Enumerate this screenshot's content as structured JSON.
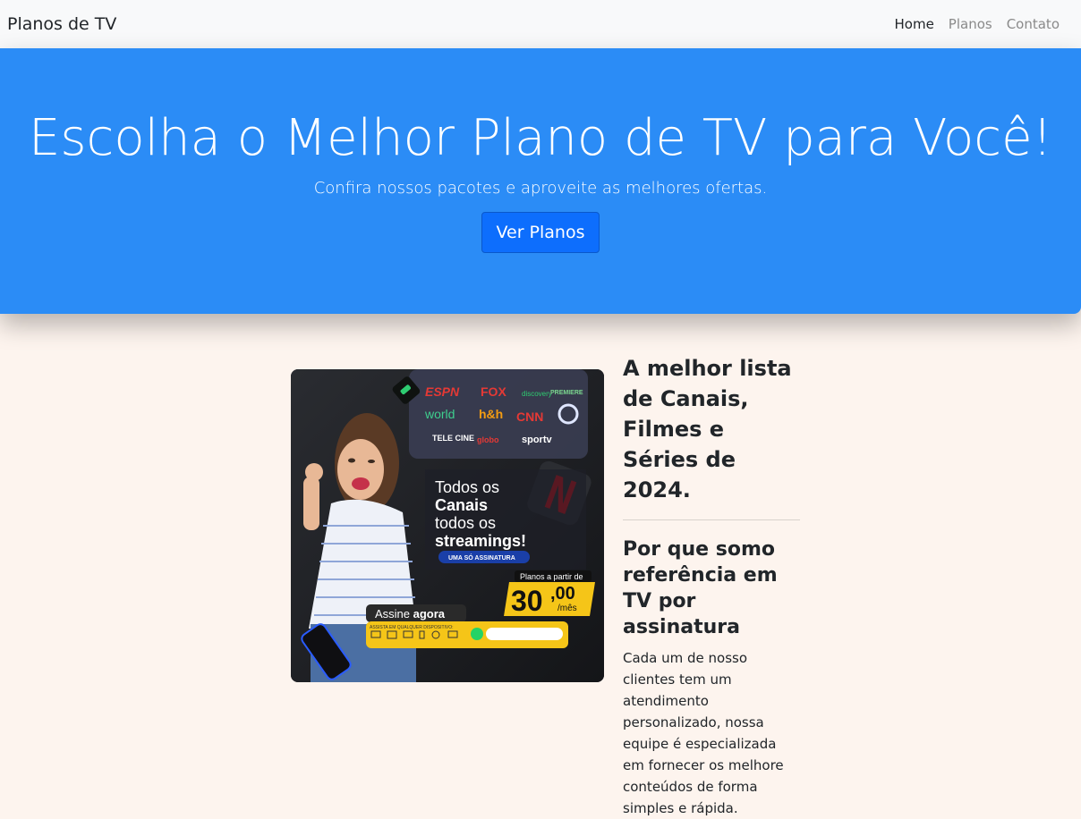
{
  "navbar": {
    "brand": "Planos de TV",
    "links": [
      "Home",
      "Planos",
      "Contato"
    ]
  },
  "hero": {
    "title": "Escolha o Melhor Plano de TV para Você!",
    "subtitle": "Confira nossos pacotes e aproveite as melhores ofertas.",
    "button": "Ver Planos"
  },
  "promo": {
    "logos": [
      "ESPN",
      "FOX",
      "discovery",
      "PREMIERE",
      "world",
      "h&h",
      "CNN",
      "TELE CINE",
      "globo",
      "sportv"
    ],
    "headline_1": "Todos os",
    "headline_2": "Canais",
    "headline_3": "todos os",
    "headline_4": "streamings!",
    "badge": "UMA SÓ ASSINATURA",
    "price_label": "Planos a partir de",
    "price_main": "30",
    "price_cents": ",00",
    "price_unit": "/mês",
    "cta_1": "Assine ",
    "cta_2": "agora",
    "devices_label": "ASSISTA EM QUALQUER DISPOSITIVO:"
  },
  "main": {
    "heading": "A melhor lista de Canais, Filmes e Séries de 2024.",
    "subheading": "Por que somo referência em TV por assinatura",
    "paragraph": "Cada um de nosso clientes tem um atendimento personalizado, nossa equipe é especializada em fornecer os melhore conteúdos de forma simples e rápida."
  },
  "colors": {
    "hero_bg": "#2b8cf6",
    "button_bg": "#0d6efd",
    "page_bg": "#fdf4ee",
    "accent_yellow": "#f5c518"
  }
}
